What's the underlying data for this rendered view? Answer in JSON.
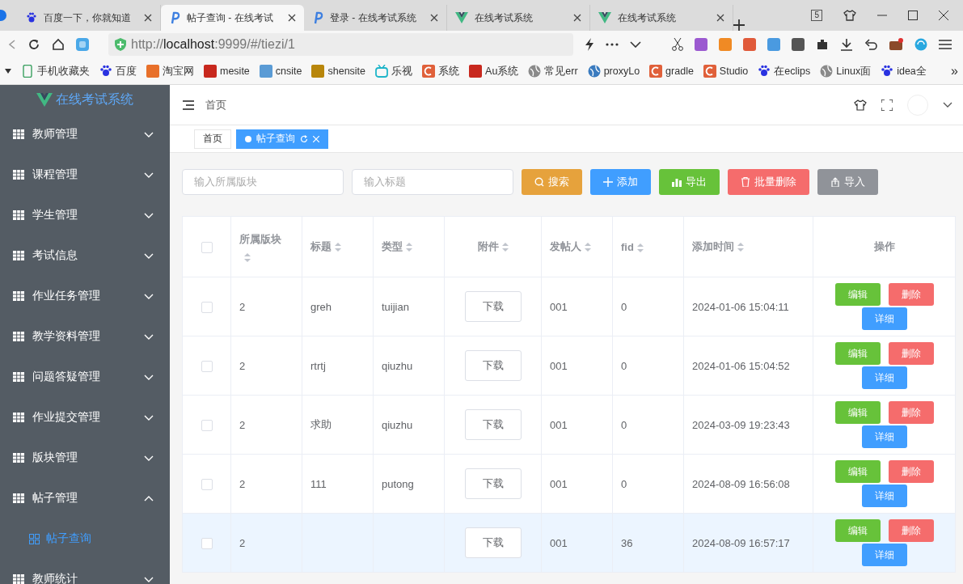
{
  "browser": {
    "tabs": [
      {
        "title": "百度一下，你就知道",
        "kind": "paw",
        "selected": false
      },
      {
        "title": "帖子查询 - 在线考试",
        "kind": "p",
        "selected": true
      },
      {
        "title": "登录 - 在线考试系统",
        "kind": "p",
        "selected": false
      },
      {
        "title": "在线考试系统",
        "kind": "v",
        "selected": false
      },
      {
        "title": "在线考试系统",
        "kind": "v",
        "selected": false
      }
    ],
    "tab_count": "5",
    "url_host": "http://localhost",
    "url_rest": ":9999/#/tiezi/1",
    "bookmarks": [
      {
        "label": "手机收藏夹",
        "kind": "phone",
        "color": "#3aa060"
      },
      {
        "label": "百度",
        "kind": "paw",
        "color": "#2932e1"
      },
      {
        "label": "淘宝网",
        "kind": "square",
        "color": "#e8702a"
      },
      {
        "label": "mesite",
        "kind": "square",
        "color": "#c8281e"
      },
      {
        "label": "cnsite",
        "kind": "square",
        "color": "#5a9bd5"
      },
      {
        "label": "shensite",
        "kind": "square",
        "color": "#b8860b"
      },
      {
        "label": "乐视",
        "kind": "tv",
        "color": "#1fb5c9"
      },
      {
        "label": "系统",
        "kind": "c",
        "color": "#e0603a"
      },
      {
        "label": "Au系统",
        "kind": "square",
        "color": "#c8281e"
      },
      {
        "label": "常见err",
        "kind": "globe",
        "color": "#8a8a8a"
      },
      {
        "label": "proxyLo",
        "kind": "globe",
        "color": "#3a7bbf"
      },
      {
        "label": "gradle",
        "kind": "c",
        "color": "#e0603a"
      },
      {
        "label": "Studio",
        "kind": "c",
        "color": "#e0603a"
      },
      {
        "label": "在eclips",
        "kind": "paw",
        "color": "#2932e1"
      },
      {
        "label": "Linux面",
        "kind": "globe",
        "color": "#8a8a8a"
      },
      {
        "label": "idea全",
        "kind": "paw",
        "color": "#2932e1"
      }
    ],
    "more_bookmarks": "»"
  },
  "app": {
    "title": "在线考试系统",
    "menu": [
      {
        "label": "教师管理",
        "expanded": false
      },
      {
        "label": "课程管理",
        "expanded": false
      },
      {
        "label": "学生管理",
        "expanded": false
      },
      {
        "label": "考试信息",
        "expanded": false
      },
      {
        "label": "作业任务管理",
        "expanded": false
      },
      {
        "label": "教学资料管理",
        "expanded": false
      },
      {
        "label": "问题答疑管理",
        "expanded": false
      },
      {
        "label": "作业提交管理",
        "expanded": false
      },
      {
        "label": "版块管理",
        "expanded": false
      },
      {
        "label": "帖子管理",
        "expanded": true,
        "children": [
          {
            "label": "帖子查询",
            "selected": true
          }
        ]
      },
      {
        "label": "教师统计",
        "expanded": false
      }
    ],
    "breadcrumb": "首页",
    "tags": [
      {
        "label": "首页",
        "selected": false
      },
      {
        "label": "帖子查询",
        "selected": true
      }
    ],
    "filters": [
      {
        "placeholder": "输入所属版块"
      },
      {
        "placeholder": "输入标题"
      }
    ],
    "actions": [
      {
        "label": "搜索",
        "kind": "search"
      },
      {
        "label": "添加",
        "kind": "add"
      },
      {
        "label": "导出",
        "kind": "export"
      },
      {
        "label": "批量删除",
        "kind": "delete"
      },
      {
        "label": "导入",
        "kind": "import"
      }
    ],
    "table": {
      "header_checked": false,
      "columns": [
        {
          "label": "所属版块",
          "sortable": true
        },
        {
          "label": "标题",
          "sortable": true
        },
        {
          "label": "类型",
          "sortable": true
        },
        {
          "label": "附件",
          "sortable": true
        },
        {
          "label": "发帖人",
          "sortable": true
        },
        {
          "label": "fid",
          "sortable": true
        },
        {
          "label": "添加时间",
          "sortable": true
        },
        {
          "label": "操作",
          "sortable": false
        }
      ],
      "rows": [
        {
          "checked": false,
          "hovered": false,
          "board": "2",
          "title": "greh",
          "type": "tuijian",
          "attachment": "下载",
          "poster": "001",
          "fid": "0",
          "time": "2024-01-06 15:04:11",
          "buttons": [
            "编辑",
            "删除",
            "详细"
          ]
        },
        {
          "checked": false,
          "hovered": false,
          "board": "2",
          "title": "rtrtj",
          "type": "qiuzhu",
          "attachment": "下载",
          "poster": "001",
          "fid": "0",
          "time": "2024-01-06 15:04:52",
          "buttons": [
            "编辑",
            "删除",
            "详细"
          ]
        },
        {
          "checked": false,
          "hovered": false,
          "board": "2",
          "title": "求助",
          "type": "qiuzhu",
          "attachment": "下载",
          "poster": "001",
          "fid": "0",
          "time": "2024-03-09 19:23:43",
          "buttons": [
            "编辑",
            "删除",
            "详细"
          ]
        },
        {
          "checked": false,
          "hovered": false,
          "board": "2",
          "title": "111",
          "type": "putong",
          "attachment": "下载",
          "poster": "001",
          "fid": "0",
          "time": "2024-08-09 16:56:08",
          "buttons": [
            "编辑",
            "删除",
            "详细"
          ]
        },
        {
          "checked": false,
          "hovered": true,
          "board": "2",
          "title": "",
          "type": "",
          "attachment": "下载",
          "poster": "001",
          "fid": "36",
          "time": "2024-08-09 16:57:17",
          "buttons": [
            "编辑",
            "删除",
            "详细"
          ]
        }
      ]
    }
  }
}
